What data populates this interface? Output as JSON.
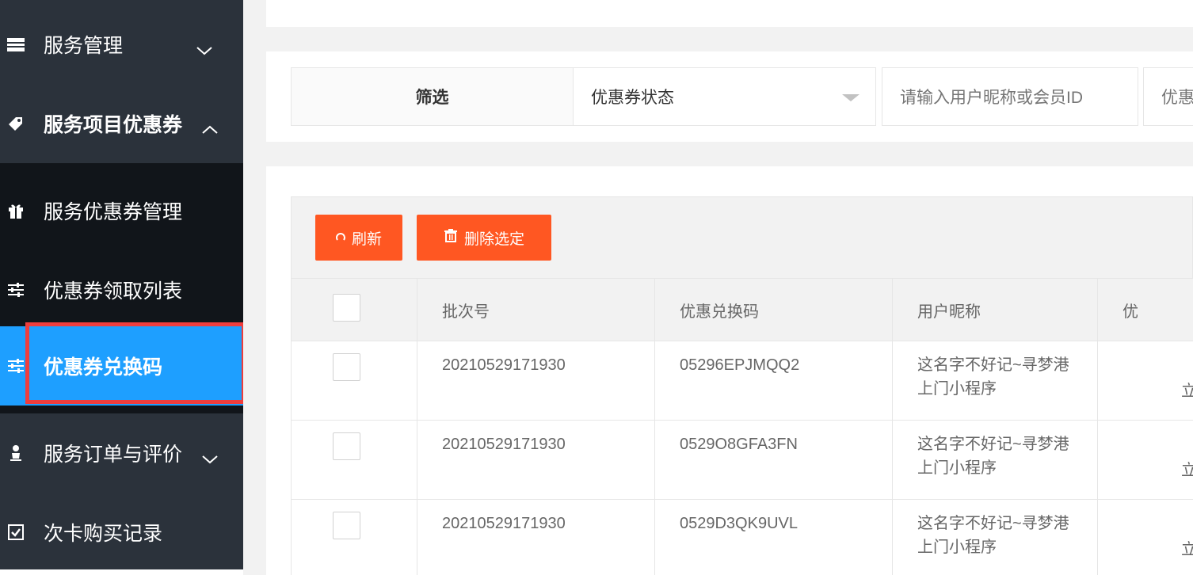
{
  "sidebar": {
    "items": [
      {
        "label": "服务管理",
        "icon": "server-icon"
      },
      {
        "label": "服务项目优惠券",
        "icon": "ticket-icon"
      },
      {
        "label": "服务优惠券管理",
        "icon": "gift-icon"
      },
      {
        "label": "优惠券领取列表",
        "icon": "sliders-icon"
      },
      {
        "label": "优惠券兑换码",
        "icon": "sliders-icon"
      },
      {
        "label": "服务订单与评价",
        "icon": "user-icon"
      },
      {
        "label": "次卡购买记录",
        "icon": "checkbox-icon"
      }
    ],
    "active_index": 4
  },
  "filter": {
    "label": "筛选",
    "status_select": "优惠券状态",
    "search_placeholder": "请输入用户昵称或会员ID",
    "extra_placeholder": "优惠券"
  },
  "toolbar": {
    "refresh_label": "刷新",
    "delete_label": "删除选定"
  },
  "table": {
    "columns": [
      "批次号",
      "优惠兑换码",
      "用户昵称",
      "优"
    ],
    "rows": [
      {
        "batch": "20210529171930",
        "code": "05296EPJMQQ2",
        "nickname": "这名字不好记~寻梦港上门小程序",
        "extra": "立"
      },
      {
        "batch": "20210529171930",
        "code": "0529O8GFA3FN",
        "nickname": "这名字不好记~寻梦港上门小程序",
        "extra": "立"
      },
      {
        "batch": "20210529171930",
        "code": "0529D3QK9UVL",
        "nickname": "这名字不好记~寻梦港上门小程序",
        "extra": "立"
      }
    ]
  },
  "colors": {
    "sidebar_bg": "#2b323b",
    "submenu_bg": "#11151a",
    "active_bg": "#1e9fff",
    "button_bg": "#ff5722",
    "highlight_border": "#ef3d3d"
  }
}
